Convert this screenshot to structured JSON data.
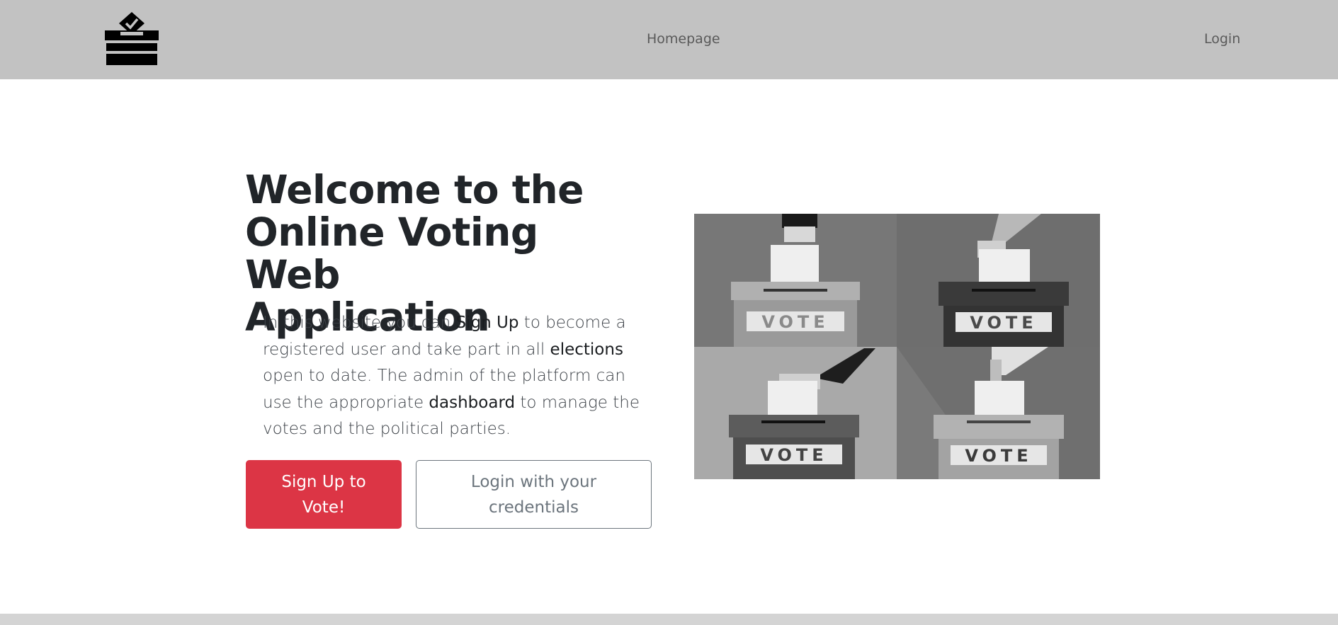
{
  "nav": {
    "logo_icon": "ballot-box-icon",
    "home_label": "Homepage",
    "login_label": "Login"
  },
  "hero": {
    "title_line1": "Welcome to the",
    "title_line2": "Online Voting Web",
    "title_line3": "Application",
    "desc_1": "In this website you can ",
    "desc_signup": "Sign Up",
    "desc_2": " to become a registered user and take part in all ",
    "desc_elections": "elections",
    "desc_3": " open to date. The admin of the platform can use the appropriate ",
    "desc_dashboard": "dashboard",
    "desc_4": " to manage the votes and the political parties.",
    "signup_button": "Sign Up to Vote!",
    "login_button": "Login with your credentials",
    "image_icon": "ballot-boxes-illustration",
    "ballot_label": "VOTE"
  },
  "colors": {
    "navbar": "#c2c2c2",
    "danger": "#dc3545",
    "secondary": "#6c757d",
    "heading": "#212529"
  }
}
